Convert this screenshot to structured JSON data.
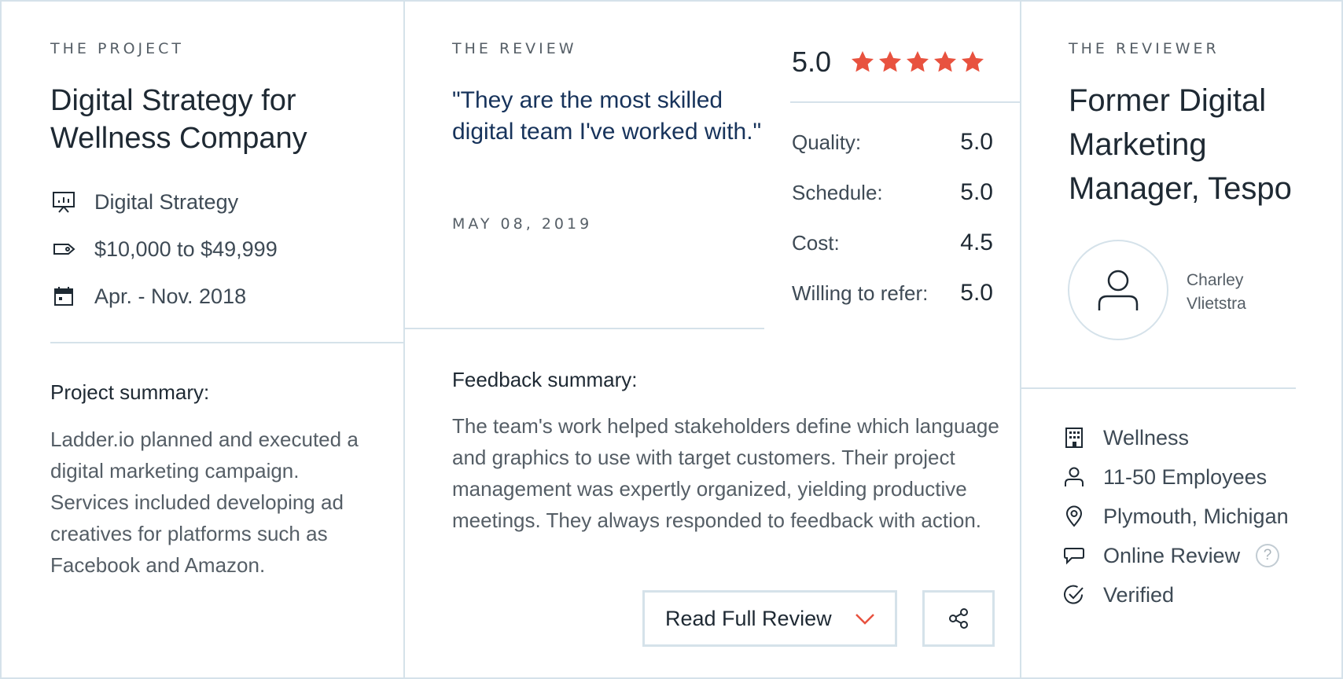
{
  "project": {
    "eyebrow": "THE PROJECT",
    "title": "Digital Strategy for Wellness Company",
    "meta": [
      {
        "icon": "presentation-chart-icon",
        "text": "Digital Strategy"
      },
      {
        "icon": "price-tag-icon",
        "text": "$10,000 to $49,999"
      },
      {
        "icon": "calendar-icon",
        "text": "Apr. - Nov. 2018"
      }
    ],
    "summary_label": "Project summary:",
    "summary_text": "Ladder.io planned and executed a digital marketing campaign. Services included developing ad creatives for platforms such as Facebook and Amazon."
  },
  "review": {
    "eyebrow": "THE REVIEW",
    "quote": "\"They are the most skilled digital team I've worked with.\"",
    "date": "MAY 08, 2019",
    "overall": "5.0",
    "stars": 5,
    "star_color": "#e8523f",
    "ratings": [
      {
        "label": "Quality:",
        "value": "5.0"
      },
      {
        "label": "Schedule:",
        "value": "5.0"
      },
      {
        "label": "Cost:",
        "value": "4.5"
      },
      {
        "label": "Willing to refer:",
        "value": "5.0"
      }
    ],
    "feedback_label": "Feedback summary:",
    "feedback_text": "The team's work helped stakeholders define which language and graphics to use with target customers. Their project management was expertly organized, yielding productive meetings. They always responded to feedback with action.",
    "read_full_label": "Read Full Review",
    "chevron_color": "#e8523f"
  },
  "reviewer": {
    "eyebrow": "THE REVIEWER",
    "title": "Former Digital Marketing Manager, Tespo",
    "name": "Charley Vlietstra",
    "info": [
      {
        "icon": "building-icon",
        "text": "Wellness"
      },
      {
        "icon": "user-icon",
        "text": "11-50 Employees"
      },
      {
        "icon": "location-pin-icon",
        "text": "Plymouth, Michigan"
      },
      {
        "icon": "chat-bubble-icon",
        "text": "Online Review"
      },
      {
        "icon": "check-circle-icon",
        "text": "Verified"
      }
    ],
    "help_glyph": "?"
  }
}
